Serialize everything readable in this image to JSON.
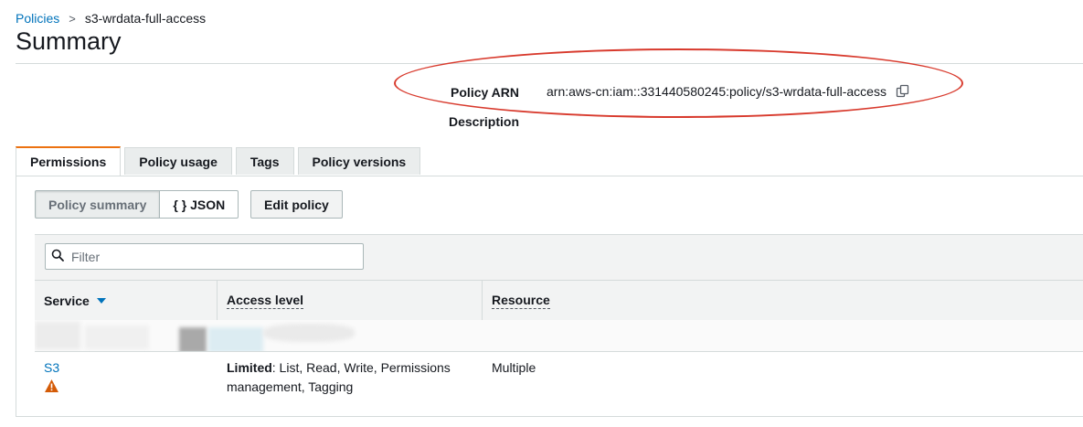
{
  "breadcrumb": {
    "parent": "Policies",
    "separator": ">",
    "current": "s3-wrdata-full-access"
  },
  "page_title": "Summary",
  "summary": {
    "arn_label": "Policy ARN",
    "arn_value": "arn:aws-cn:iam::331440580245:policy/s3-wrdata-full-access",
    "description_label": "Description",
    "description_value": ""
  },
  "tabs": [
    {
      "label": "Permissions",
      "active": true
    },
    {
      "label": "Policy usage",
      "active": false
    },
    {
      "label": "Tags",
      "active": false
    },
    {
      "label": "Policy versions",
      "active": false
    }
  ],
  "buttons": {
    "policy_summary": "Policy summary",
    "json": "{ } JSON",
    "edit_policy": "Edit policy"
  },
  "filter": {
    "placeholder": "Filter",
    "value": ""
  },
  "table": {
    "columns": [
      "Service",
      "Access level",
      "Resource"
    ],
    "rows": [
      {
        "service": "S3",
        "warning": true,
        "access_level_prefix": "Limited",
        "access_level_rest": ": List, Read, Write, Permissions management, Tagging",
        "resource": "Multiple"
      }
    ]
  },
  "colors": {
    "accent_tab": "#ec7211",
    "link": "#0073bb",
    "annotation_ellipse": "#d83a2d",
    "warning": "#d45b07"
  },
  "icons": {
    "search": "search-icon",
    "copy": "copy-icon",
    "sort": "sort-desc-icon",
    "warning": "warning-icon"
  }
}
